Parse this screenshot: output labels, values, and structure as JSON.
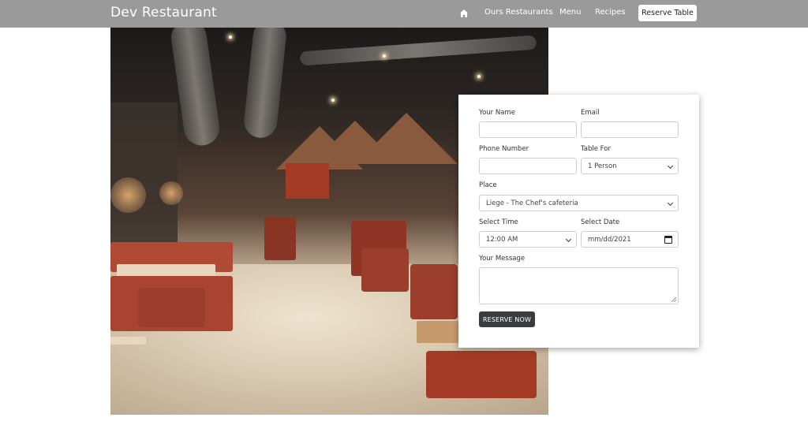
{
  "navbar": {
    "brand": "Dev Restaurant",
    "home_icon": "home-icon",
    "links": [
      "Ours Restaurants",
      "Menu",
      "Recipes"
    ],
    "cta": "Reserve Table",
    "background": "#9a9a9a"
  },
  "hero": {
    "image": "restaurant-interior-photo"
  },
  "form": {
    "name_label": "Your Name",
    "email_label": "Email",
    "phone_label": "Phone Number",
    "table_for_label": "Table For",
    "table_for_value": "1 Person",
    "place_label": "Place",
    "place_value": "Liege - The Chef's cafeteria",
    "time_label": "Select Time",
    "time_value": "12:00 AM",
    "date_label": "Select Date",
    "date_value": "mm/dd/2021",
    "message_label": "Your Message",
    "submit_label": "RESERVE NOW",
    "button_color": "#3a3d40"
  }
}
